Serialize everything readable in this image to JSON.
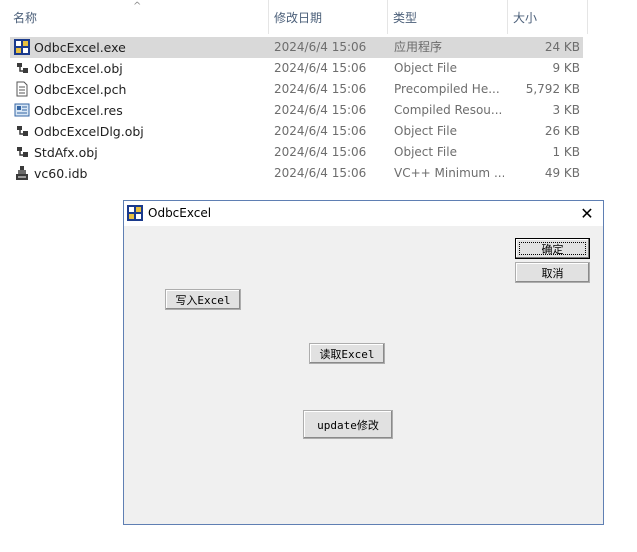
{
  "explorer": {
    "columns": {
      "name": "名称",
      "date": "修改日期",
      "type": "类型",
      "size": "大小"
    },
    "files": [
      {
        "name": "OdbcExcel.exe",
        "date": "2024/6/4 15:06",
        "type": "应用程序",
        "size": "24 KB",
        "icon": "exe-app-icon",
        "selected": true
      },
      {
        "name": "OdbcExcel.obj",
        "date": "2024/6/4 15:06",
        "type": "Object File",
        "size": "9 KB",
        "icon": "object-file-icon"
      },
      {
        "name": "OdbcExcel.pch",
        "date": "2024/6/4 15:06",
        "type": "Precompiled He...",
        "size": "5,792 KB",
        "icon": "document-file-icon"
      },
      {
        "name": "OdbcExcel.res",
        "date": "2024/6/4 15:06",
        "type": "Compiled Resou...",
        "size": "3 KB",
        "icon": "resource-file-icon"
      },
      {
        "name": "OdbcExcelDlg.obj",
        "date": "2024/6/4 15:06",
        "type": "Object File",
        "size": "26 KB",
        "icon": "object-file-icon"
      },
      {
        "name": "StdAfx.obj",
        "date": "2024/6/4 15:06",
        "type": "Object File",
        "size": "1 KB",
        "icon": "object-file-icon"
      },
      {
        "name": "vc60.idb",
        "date": "2024/6/4 15:06",
        "type": "VC++ Minimum ...",
        "size": "49 KB",
        "icon": "idb-file-icon"
      }
    ]
  },
  "dialog": {
    "title": "OdbcExcel",
    "close_glyph": "✕",
    "ok_label": "确定",
    "cancel_label": "取消",
    "write_excel_label": "写入Excel",
    "read_excel_label": "读取Excel",
    "update_label": "update修改"
  },
  "colors": {
    "selected_row": "#d9d9d9",
    "header_text": "#4c607a",
    "dialog_border": "#5f7fb3",
    "dialog_bg": "#f0f0f0"
  }
}
